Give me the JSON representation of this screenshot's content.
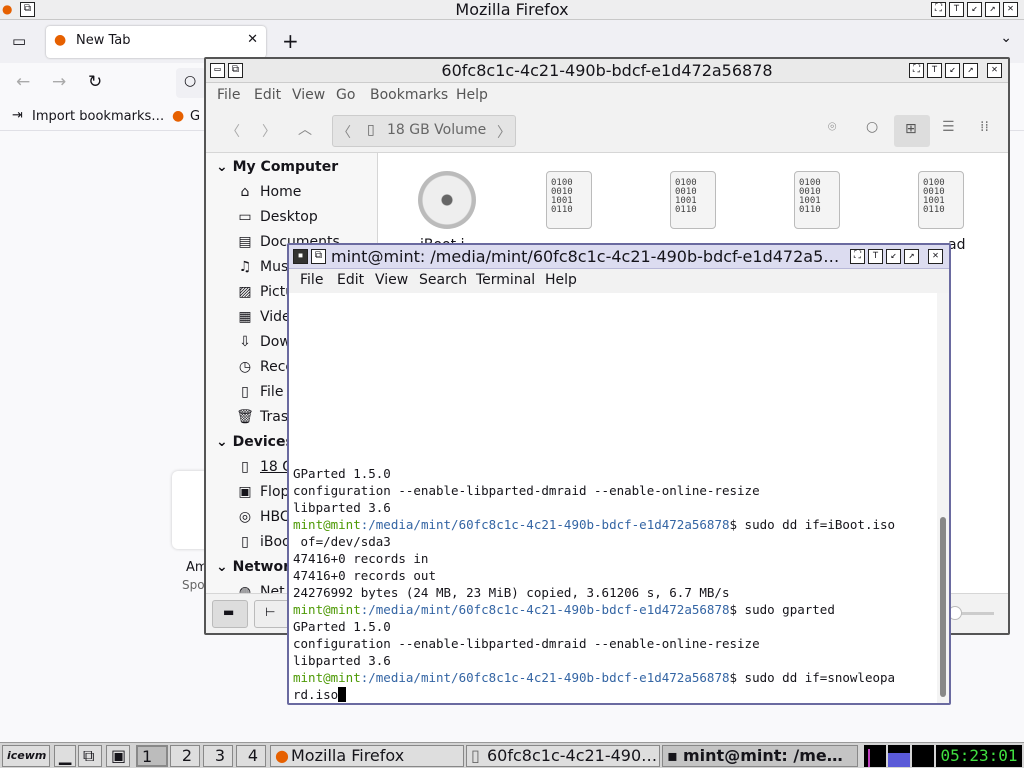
{
  "firefox": {
    "window_title": "Mozilla Firefox",
    "tab_label": "New Tab",
    "new_tab": "+",
    "bookmark_import": "Import bookmarks…",
    "bookmark_g": "G",
    "bg_text_1": "Am",
    "bg_text_2": "Spo"
  },
  "nemo": {
    "title": "60fc8c1c-4c21-490b-bdcf-e1d472a56878",
    "menu": [
      "File",
      "Edit",
      "View",
      "Go",
      "Bookmarks",
      "Help"
    ],
    "location": "18 GB Volume",
    "sidebar": {
      "my_computer": "My Computer",
      "items": [
        "Home",
        "Desktop",
        "Documents",
        "Mus",
        "Pictu",
        "Vide",
        "Dow",
        "Rece",
        "File S",
        "Trasl"
      ],
      "devices": "Devices",
      "device_items": [
        "18 G",
        "Flop",
        "HBC",
        "iBoo"
      ],
      "network": "Networ",
      "network_items": [
        "Net"
      ]
    },
    "files": [
      "iBoot.iso",
      "",
      "",
      "",
      "snowleopard"
    ],
    "file_glyph": "0100\n0010\n1001\n0110",
    "file_labels_visible": [
      "iBoot.i",
      "",
      "",
      "",
      "ad"
    ]
  },
  "terminal": {
    "title": "mint@mint: /media/mint/60fc8c1c-4c21-490b-bdcf-e1d472a5…",
    "menu": [
      "File",
      "Edit",
      "View",
      "Search",
      "Terminal",
      "Help"
    ],
    "user": "mint@mint",
    "path": ":/media/mint/60fc8c1c-4c21-490b-bdcf-e1d472a56878",
    "lines": [
      "GParted 1.5.0",
      "configuration --enable-libparted-dmraid --enable-online-resize",
      "libparted 3.6",
      "$ sudo dd if=iBoot.iso",
      " of=/dev/sda3",
      "47416+0 records in",
      "47416+0 records out",
      "24276992 bytes (24 MB, 23 MiB) copied, 3.61206 s, 6.7 MB/s",
      "$ sudo gparted",
      "GParted 1.5.0",
      "configuration --enable-libparted-dmraid --enable-online-resize",
      "libparted 3.6",
      "$ sudo dd if=snowleopa",
      "rd.iso"
    ]
  },
  "taskbar": {
    "start": "icewm",
    "workspaces": [
      "1",
      "2",
      "3",
      "4"
    ],
    "tasks": [
      "Mozilla Firefox",
      "60fc8c1c-4c21-490…",
      "mint@mint: /me…"
    ],
    "clock": "05:23:01"
  }
}
